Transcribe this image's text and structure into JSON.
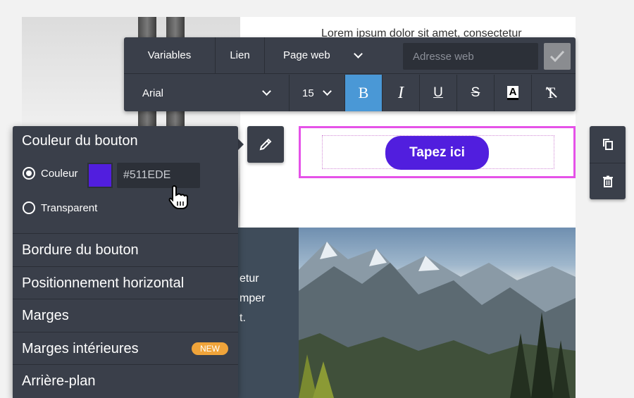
{
  "canvas": {
    "lorem_top": "Lorem ipsum dolor sit amet, consectetur",
    "dark_text": [
      "etur",
      "mper",
      "t."
    ],
    "cta_label": "Tapez ici",
    "cta_color": "#511EDE"
  },
  "toolbar": {
    "variables_label": "Variables",
    "link_label": "Lien",
    "link_type": "Page web",
    "url_placeholder": "Adresse web",
    "font_family": "Arial",
    "font_size": "15",
    "bold_label": "B",
    "italic_label": "I",
    "underline_label": "U",
    "strike_label": "S",
    "text_color_label": "A",
    "clear_label": "T",
    "active_button": "bold"
  },
  "panel": {
    "title": "Couleur du bouton",
    "color_option": "Couleur",
    "color_hex": "#511EDE",
    "transparent_option": "Transparent",
    "selected_option": "Couleur",
    "items": [
      {
        "label": "Bordure du bouton"
      },
      {
        "label": "Positionnement horizontal"
      },
      {
        "label": "Marges"
      },
      {
        "label": "Marges intérieures",
        "badge": "NEW"
      },
      {
        "label": "Arrière-plan"
      }
    ]
  },
  "icons": {
    "edit": "pencil-icon",
    "duplicate": "copy-icon",
    "delete": "trash-icon",
    "confirm": "check-icon"
  },
  "colors": {
    "selection_outline": "#E552E8",
    "active_format": "#4A98D6",
    "badge": "#F0A43A",
    "panel_bg": "#3A3F4A"
  }
}
